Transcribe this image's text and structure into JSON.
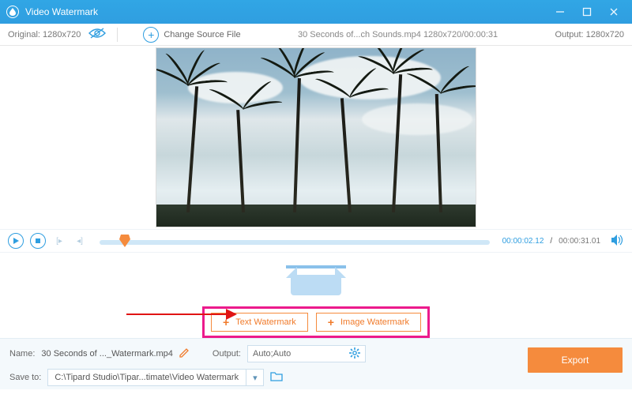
{
  "titlebar": {
    "title": "Video Watermark"
  },
  "toolbar": {
    "original_label": "Original: 1280x720",
    "change_source_label": "Change Source File",
    "file_info": "30 Seconds of...ch Sounds.mp4    1280x720/00:00:31",
    "output_label": "Output: 1280x720"
  },
  "transport": {
    "current_time": "00:00:02.12",
    "sep": "/",
    "total_time": "00:00:31.01"
  },
  "watermark": {
    "text_btn": "Text Watermark",
    "image_btn": "Image Watermark"
  },
  "footer": {
    "name_label": "Name:",
    "name_value": "30 Seconds of ..._Watermark.mp4",
    "output_label": "Output:",
    "output_value": "Auto;Auto",
    "save_label": "Save to:",
    "save_path": "C:\\Tipard Studio\\Tipar...timate\\Video Watermark",
    "export_label": "Export"
  }
}
